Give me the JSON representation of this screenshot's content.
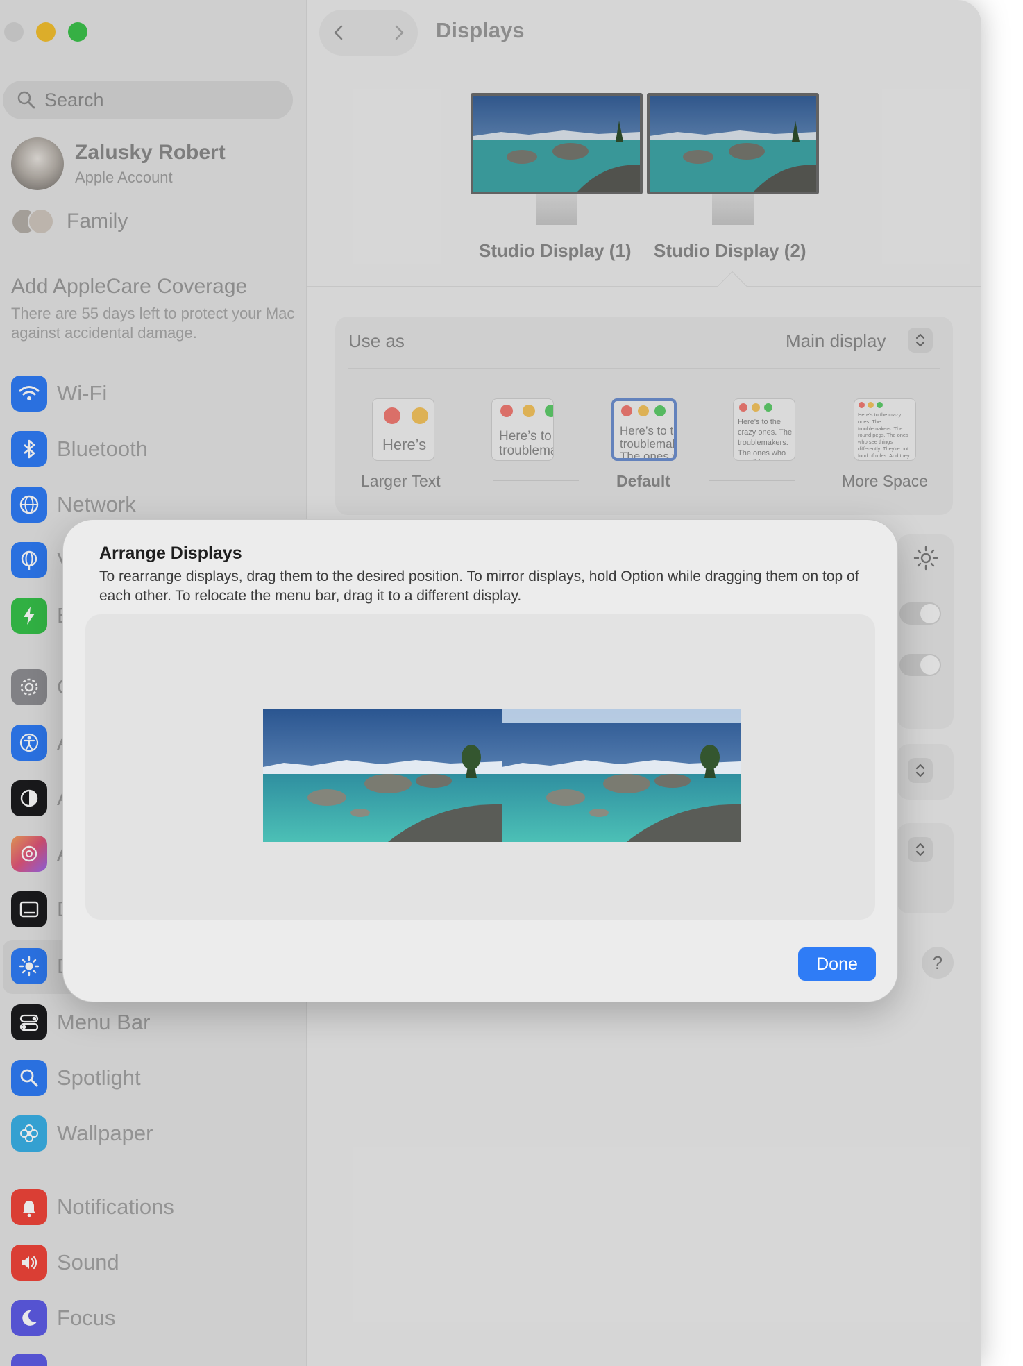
{
  "window": {
    "title": "Displays",
    "traffic_lights": {
      "close": "#d2d2d2",
      "minimize": "#f2bf2f",
      "maximize": "#3cc24b"
    }
  },
  "sidebar": {
    "search_placeholder": "Search",
    "account": {
      "name": "Zalusky Robert",
      "subtitle": "Apple Account"
    },
    "family_label": "Family",
    "applecare": {
      "title": "Add AppleCare Coverage",
      "subtitle": "There are 55 days left to protect your Mac against accidental damage."
    },
    "items": [
      {
        "label": "Wi-Fi",
        "icon": "wifi-icon",
        "color": "#2f7cf6"
      },
      {
        "label": "Bluetooth",
        "icon": "bluetooth-icon",
        "color": "#2f7cf6"
      },
      {
        "label": "Network",
        "icon": "globe-icon",
        "color": "#2f7cf6"
      },
      {
        "label": "V",
        "icon": "vpn-globe-icon",
        "color": "#2f7cf6"
      },
      {
        "label": "B",
        "icon": "battery-bolt-icon",
        "color": "#36c24a"
      },
      {
        "label": "G",
        "icon": "gear-icon",
        "color": "#8e8e93"
      },
      {
        "label": "A",
        "icon": "accessibility-icon",
        "color": "#2f7cf6"
      },
      {
        "label": "A",
        "icon": "appearance-icon",
        "color": "#1c1c1e"
      },
      {
        "label": "A",
        "icon": "siri-flower-icon",
        "color": "#e08a5a"
      },
      {
        "label": "D",
        "icon": "desktop-dock-icon",
        "color": "#1c1c1e"
      },
      {
        "label": "D",
        "icon": "displays-sun-icon",
        "color": "#2f7cf6"
      },
      {
        "label": "Menu Bar",
        "icon": "menubar-toggle-icon",
        "color": "#1c1c1e"
      },
      {
        "label": "Spotlight",
        "icon": "magnifier-icon",
        "color": "#2f7cf6"
      },
      {
        "label": "Wallpaper",
        "icon": "flower-icon",
        "color": "#3ab0e6"
      },
      {
        "label": "Notifications",
        "icon": "bell-icon",
        "color": "#f0453a"
      },
      {
        "label": "Sound",
        "icon": "speaker-icon",
        "color": "#f0453a"
      },
      {
        "label": "Focus",
        "icon": "moon-icon",
        "color": "#5e5ce6"
      }
    ]
  },
  "main": {
    "monitors": [
      {
        "label": "Studio Display (1)"
      },
      {
        "label": "Studio Display (2)"
      }
    ],
    "use_as_label": "Use as",
    "use_as_value": "Main display",
    "resolutions": [
      {
        "label": "Larger Text",
        "sample": "Here’s"
      },
      {
        "label": "",
        "sample": "Here’s to the troublemakers"
      },
      {
        "label": "Default",
        "sample": "Here’s to the troublemakers. The ones who"
      },
      {
        "label": "",
        "sample": "Here's to the crazy ones. The troublemakers. The ones who see things differently. rules. And they"
      },
      {
        "label": "More Space",
        "sample": "Here's to the crazy ones. The troublemakers. The round pegs. The ones who see things differently. They're not fond of rules. And they have no respect. You can quote them, disagree with them. About the only thing. Because they change things."
      }
    ],
    "help_label": "?"
  },
  "dialog": {
    "title": "Arrange Displays",
    "description": "To rearrange displays, drag them to the desired position. To mirror displays, hold Option while dragging them on top of each other. To relocate the menu bar, drag it to a different display.",
    "done_label": "Done",
    "accent_color": "#2f7cf6"
  }
}
